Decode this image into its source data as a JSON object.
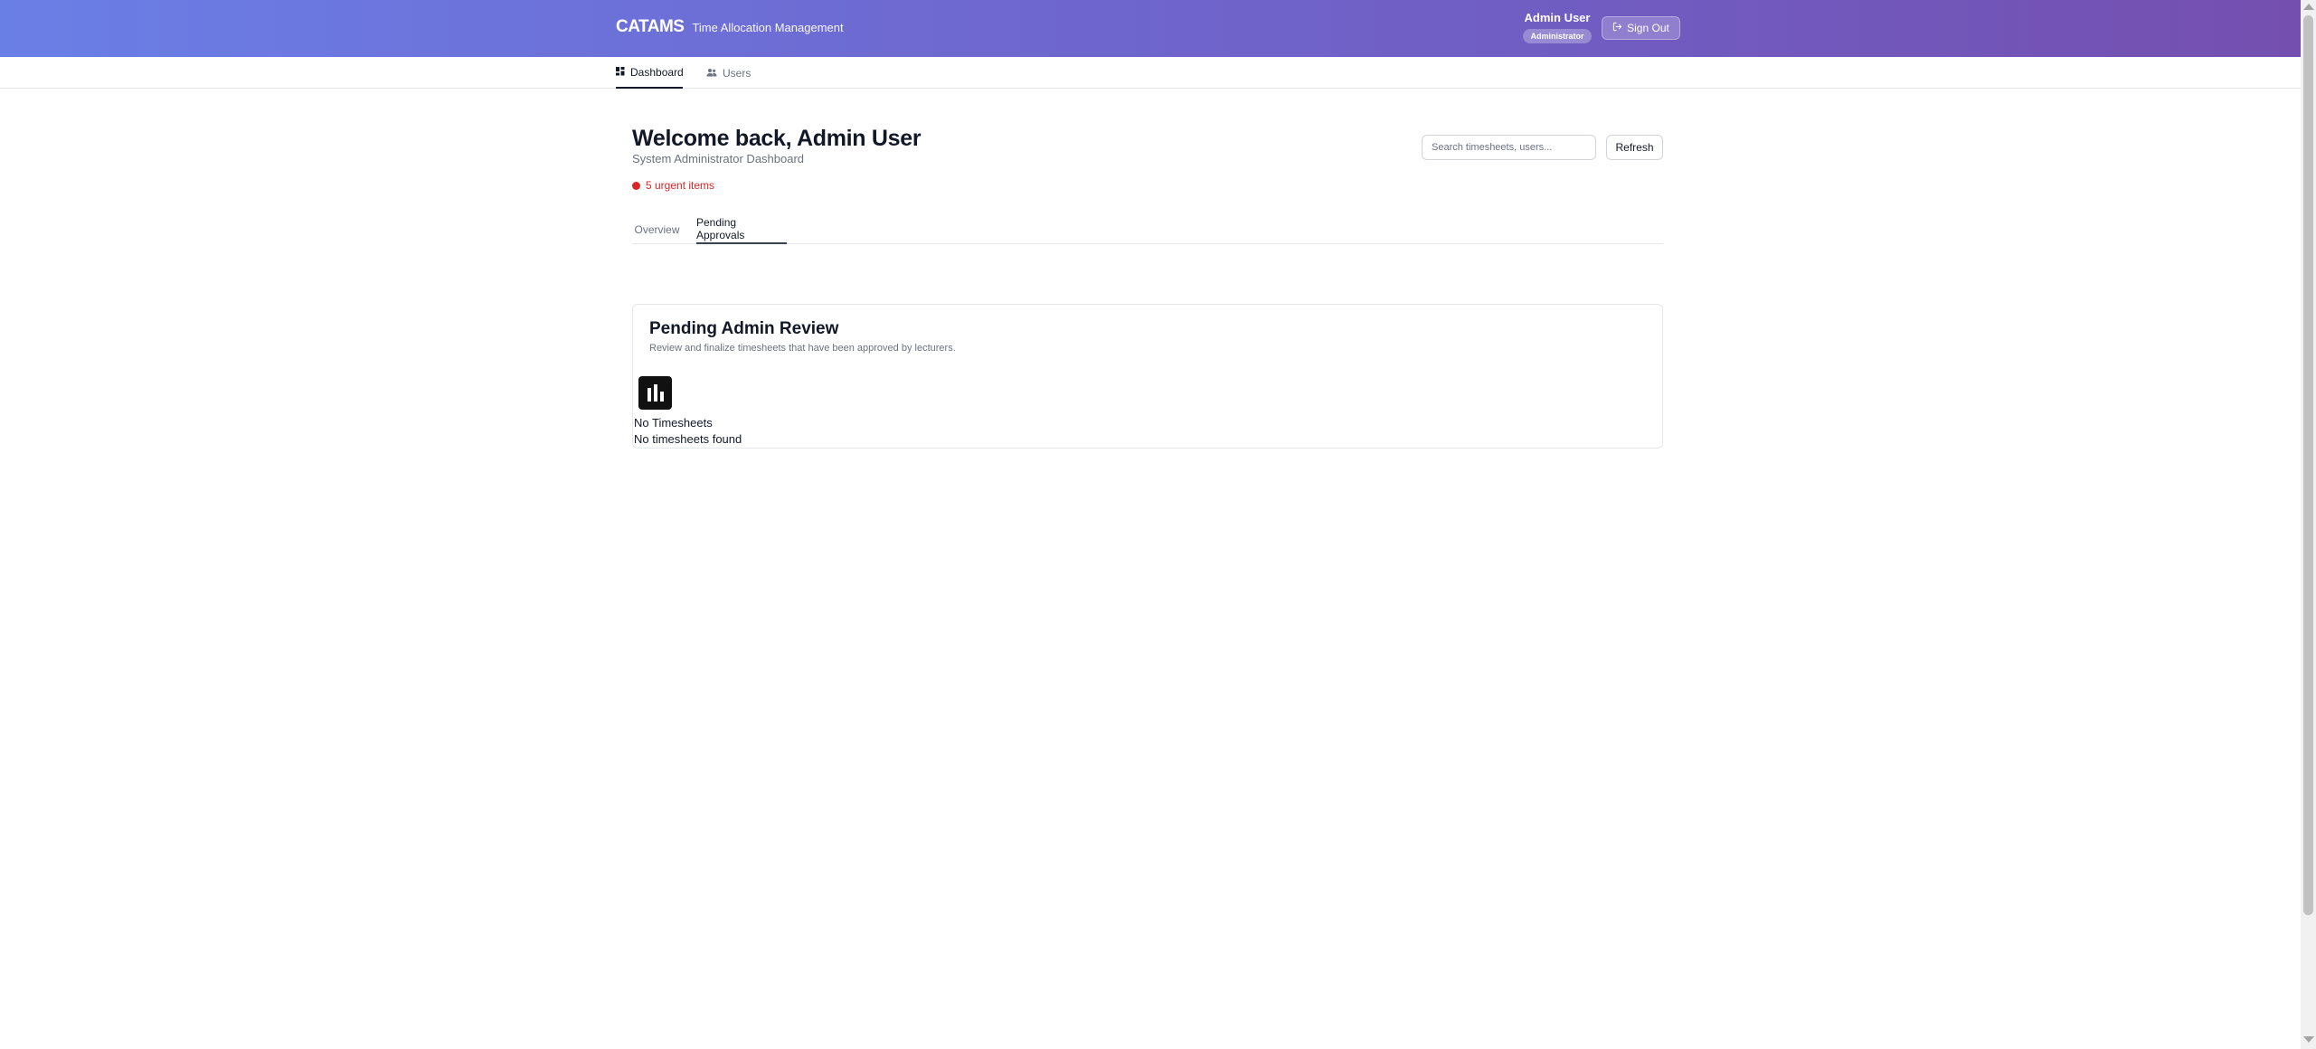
{
  "header": {
    "brand_title": "CATAMS",
    "brand_subtitle": "Time Allocation Management",
    "user_name": "Admin User",
    "user_role": "Administrator",
    "signout_label": "Sign Out",
    "signout_icon": "sign-out-icon"
  },
  "nav": {
    "items": [
      {
        "label": "Dashboard",
        "icon": "dashboard-icon",
        "active": true
      },
      {
        "label": "Users",
        "icon": "users-icon",
        "active": false
      }
    ]
  },
  "page": {
    "title": "Welcome back, Admin User",
    "subtitle": "System Administrator Dashboard",
    "urgent_text": "5 urgent items",
    "search_placeholder": "Search timesheets, users...",
    "search_value": "",
    "refresh_label": "Refresh"
  },
  "tabs": [
    {
      "label": "Overview",
      "active": false
    },
    {
      "label": "Pending Approvals",
      "active": true
    }
  ],
  "review": {
    "title": "Pending Admin Review",
    "description": "Review and finalize timesheets that have been approved by lecturers.",
    "empty_icon": "bar-chart-icon",
    "empty_title": "No Timesheets",
    "empty_description": "No timesheets found"
  },
  "colors": {
    "header_gradient_start": "#6a7fe6",
    "header_gradient_end": "#744fb0",
    "urgent": "#dc2626"
  }
}
